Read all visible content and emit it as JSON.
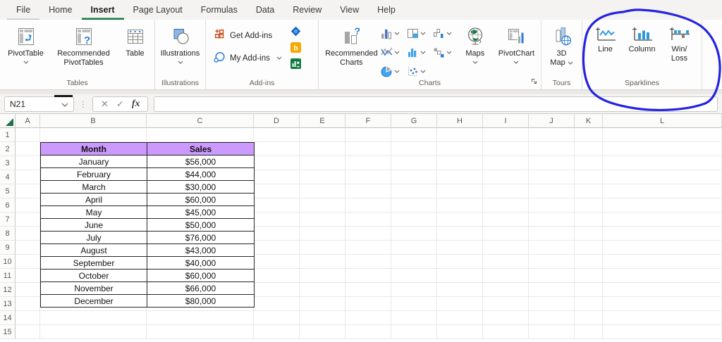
{
  "ribbon": {
    "tabs": [
      "File",
      "Home",
      "Insert",
      "Page Layout",
      "Formulas",
      "Data",
      "Review",
      "View",
      "Help"
    ],
    "active_tab": "Insert",
    "groups": {
      "tables": {
        "label": "Tables",
        "pivottable": "PivotTable",
        "recommended_pivottables": "Recommended PivotTables",
        "table": "Table"
      },
      "illustrations": {
        "label": "Illustrations",
        "illustrations": "Illustrations"
      },
      "addins": {
        "label": "Add-ins",
        "get_addins": "Get Add-ins",
        "my_addins": "My Add-ins"
      },
      "charts": {
        "label": "Charts",
        "recommended_charts": "Recommended Charts",
        "maps": "Maps",
        "pivotchart": "PivotChart"
      },
      "tours": {
        "label": "Tours",
        "map3d_line1": "3D",
        "map3d_line2": "Map"
      },
      "sparklines": {
        "label": "Sparklines",
        "line": "Line",
        "column": "Column",
        "winloss_line1": "Win/",
        "winloss_line2": "Loss"
      }
    }
  },
  "formula_bar": {
    "name_box": "N21",
    "cancel_icon": "✕",
    "enter_icon": "✓",
    "fx_label": "fx",
    "dots": "⋮",
    "formula_value": ""
  },
  "sheet": {
    "column_headers": [
      "A",
      "B",
      "C",
      "D",
      "E",
      "F",
      "G",
      "H",
      "I",
      "J",
      "K",
      "L"
    ],
    "row_count": 15
  },
  "table": {
    "headers": [
      "Month",
      "Sales"
    ],
    "header_fill": "#CC99FF",
    "rows": [
      [
        "January",
        "$56,000"
      ],
      [
        "February",
        "$44,000"
      ],
      [
        "March",
        "$30,000"
      ],
      [
        "April",
        "$60,000"
      ],
      [
        "May",
        "$45,000"
      ],
      [
        "June",
        "$50,000"
      ],
      [
        "July",
        "$76,000"
      ],
      [
        "August",
        "$43,000"
      ],
      [
        "September",
        "$40,000"
      ],
      [
        "October",
        "$60,000"
      ],
      [
        "November",
        "$66,000"
      ],
      [
        "December",
        "$80,000"
      ]
    ]
  },
  "annotation": {
    "shape": "hand-drawn ellipse",
    "highlights": "Sparklines group",
    "color": "#2522E2"
  }
}
